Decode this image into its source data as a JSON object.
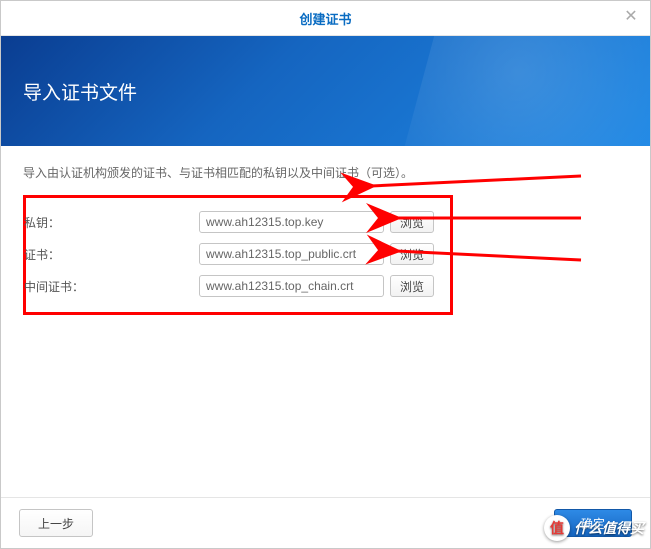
{
  "dialog": {
    "title": "创建证书",
    "banner_title": "导入证书文件"
  },
  "description": "导入由认证机构颁发的证书、与证书相匹配的私钥以及中间证书（可选）。",
  "fields": {
    "private_key": {
      "label": "私钥：",
      "value": "www.ah12315.top.key",
      "browse": "浏览"
    },
    "certificate": {
      "label": "证书：",
      "value": "www.ah12315.top_public.crt",
      "browse": "浏览"
    },
    "intermediate": {
      "label": "中间证书：",
      "value": "www.ah12315.top_chain.crt",
      "browse": "浏览"
    }
  },
  "footer": {
    "prev": "上一步",
    "confirm": "确定"
  },
  "watermark": {
    "badge": "值",
    "text": "什么值得买"
  }
}
